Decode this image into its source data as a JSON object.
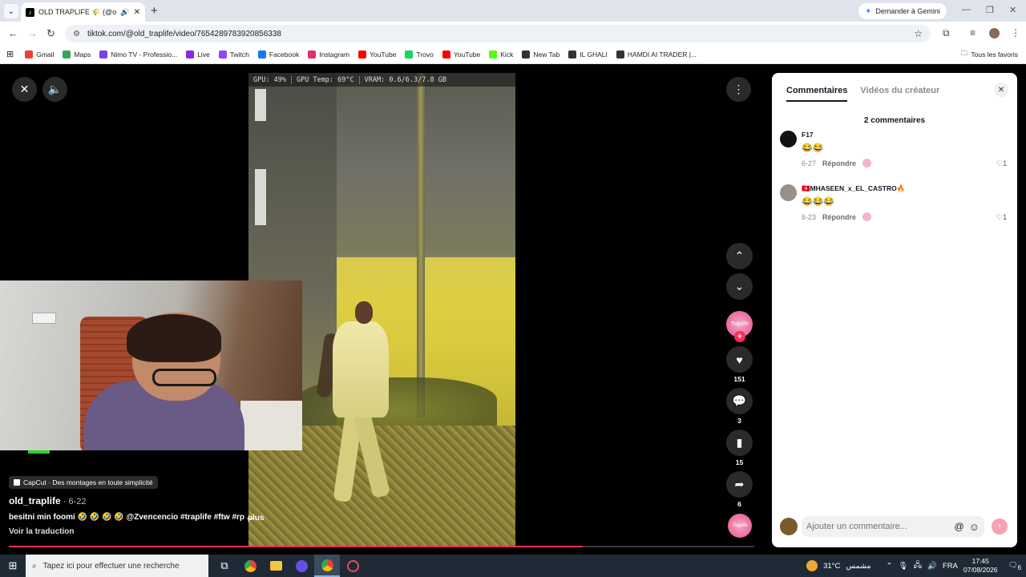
{
  "browser": {
    "tab_title": "OLD TRAPLIFE 🌾 (@old_tr",
    "tab_favicon": "tiktok-icon",
    "gemini_label": "Demander à Gemini",
    "url": "tiktok.com/@old_traplife/video/7654289783920856338"
  },
  "bookmarks": {
    "items": [
      {
        "label": "Gmail",
        "color": "#ea4335"
      },
      {
        "label": "Maps",
        "color": "#34a853"
      },
      {
        "label": "Nimo TV - Professio...",
        "color": "#7b3fe4"
      },
      {
        "label": "Live",
        "color": "#8a2be2"
      },
      {
        "label": "Twitch",
        "color": "#9146ff"
      },
      {
        "label": "Facebook",
        "color": "#1877f2"
      },
      {
        "label": "Instagram",
        "color": "#e1306c"
      },
      {
        "label": "YouTube",
        "color": "#ff0000"
      },
      {
        "label": "Trovo",
        "color": "#19d65c"
      },
      {
        "label": "YouTube",
        "color": "#ff0000"
      },
      {
        "label": "Kick",
        "color": "#53fc18"
      },
      {
        "label": "New Tab",
        "color": "#333333"
      },
      {
        "label": "IL GHALI",
        "color": "#333333"
      },
      {
        "label": "HAMDI AI TRADER |...",
        "color": "#333333"
      }
    ],
    "all_label": "Tous les favoris"
  },
  "video": {
    "osd": {
      "gpu": "GPU: 49%",
      "temp": "GPU Temp: 69°C",
      "vram": "VRAM: 0.6/6.3/7.8 GB"
    },
    "capcut_badge": "CapCut · Des montages en toute simplicité",
    "author": "old_traplife",
    "date": " · 6-22",
    "caption": "besitni min foomi 🤣 🤣 🤣 🤣 @Zvencencio #traplife #ftw #rp ...",
    "more_label": "plus",
    "translate_label": "Voir la traduction",
    "progress": 0.77
  },
  "rail": {
    "avatar_text": "Traplife",
    "likes": "151",
    "comments": "3",
    "saves": "15",
    "shares": "6",
    "accent": "#fe2c55"
  },
  "panel": {
    "tab_comments": "Commentaires",
    "tab_videos": "Vidéos du créateur",
    "count_label": "2 commentaires",
    "comments": [
      {
        "user": "F17",
        "text": "😂😂",
        "date": "6-27",
        "reply": "Répondre",
        "likes": "1"
      },
      {
        "user": "🇹🇳MHASEEN_x_EL_CASTRO🔥",
        "text": "😂😂😂",
        "date": "6-23",
        "reply": "Répondre",
        "likes": "1"
      }
    ],
    "input_placeholder": "Ajouter un commentaire..."
  },
  "taskbar": {
    "search_placeholder": "Tapez ici pour effectuer une recherche",
    "temperature": "31°C",
    "weather": "مشمس",
    "lang": "FRA",
    "time": "17:45",
    "date": "07/08/2026",
    "notif_count": "6"
  }
}
